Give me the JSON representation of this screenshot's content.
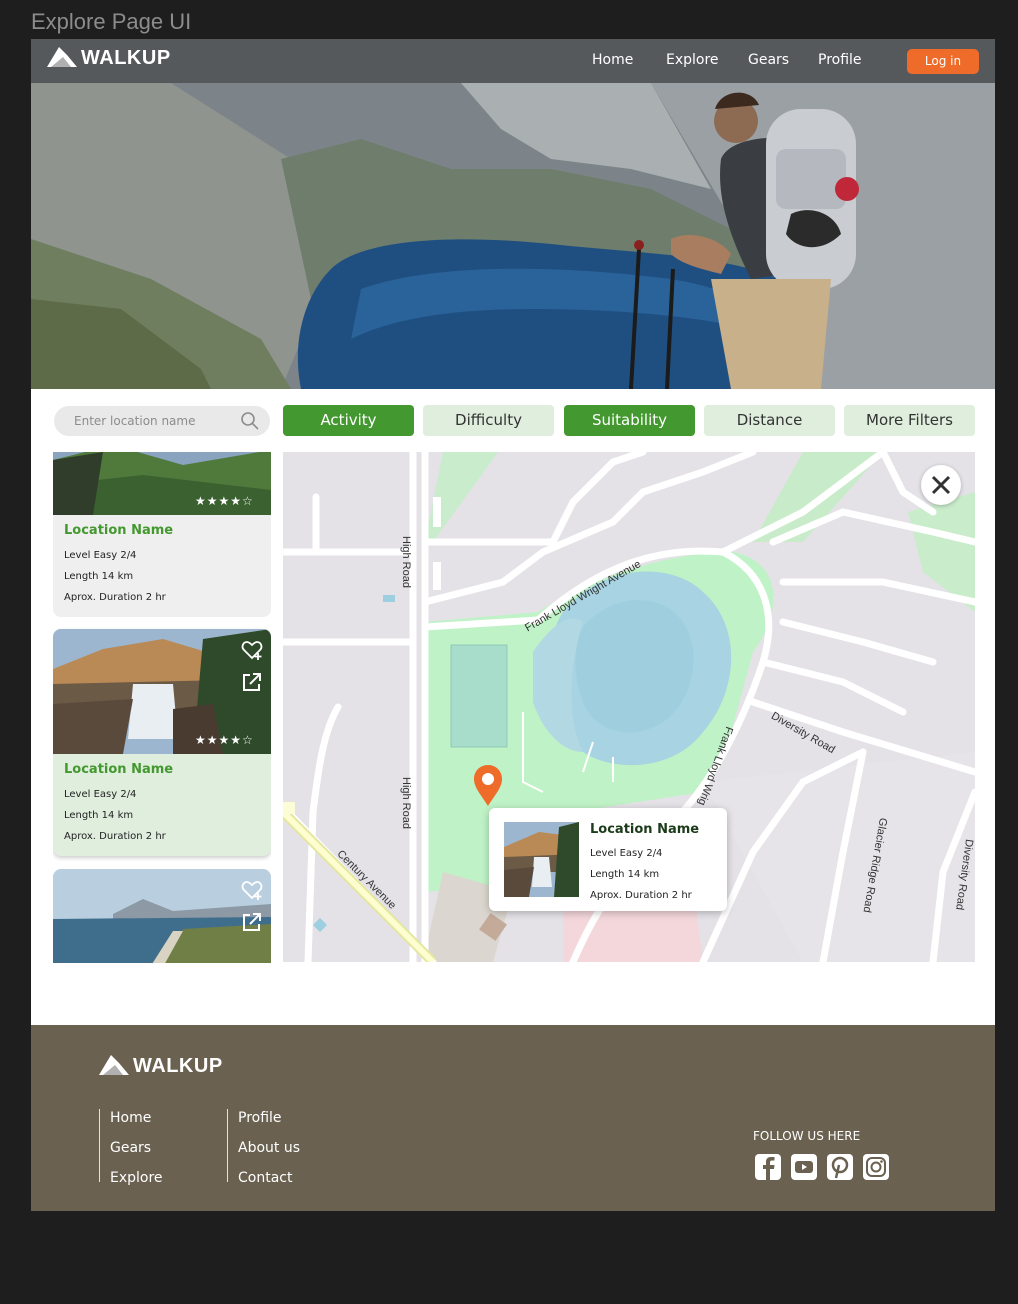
{
  "frame_title": "Explore Page UI",
  "brand": "WALKUP",
  "nav": {
    "links": [
      "Home",
      "Explore",
      "Gears",
      "Profile"
    ],
    "login": "Log in"
  },
  "search": {
    "placeholder": "Enter location name"
  },
  "filters": [
    {
      "label": "Activity",
      "active": true
    },
    {
      "label": "Difficulty",
      "active": false
    },
    {
      "label": "Suitability",
      "active": true
    },
    {
      "label": "Distance",
      "active": false
    },
    {
      "label": "More Filters",
      "active": false
    }
  ],
  "cards": [
    {
      "title": "Location Name",
      "level": "Level Easy 2/4",
      "length": "Length  14 km",
      "duration": "Aprox. Duration 2 hr",
      "rating": 4,
      "stars": "★★★★☆"
    },
    {
      "title": "Location Name",
      "level": "Level Easy 2/4",
      "length": "Length  14 km",
      "duration": "Aprox. Duration 2 hr",
      "rating": 4,
      "stars": "★★★★☆"
    }
  ],
  "map": {
    "roads": [
      "Frank Lloyd Wright Avenue",
      "High Road",
      "High Road",
      "Diversity Road",
      "Frank Lloyd Wrig",
      "Century Avenue",
      "Glacier Ridge Road",
      "Diversity Road"
    ],
    "popup": {
      "title": "Location Name",
      "level": "Level Easy 2/4",
      "length": "Length  14 km",
      "duration": "Aprox. Duration 2 hr"
    }
  },
  "footer": {
    "brand": "WALKUP",
    "col1": [
      "Home",
      "Gears",
      "Explore"
    ],
    "col2": [
      "Profile",
      "About us",
      "Contact"
    ],
    "follow": "FOLLOW US HERE",
    "social_icons": [
      "facebook-icon",
      "youtube-icon",
      "pinterest-icon",
      "instagram-icon"
    ]
  },
  "colors": {
    "accent_green": "#43982f",
    "accent_orange": "#ee6b2a",
    "footer_bg": "#6a6150"
  }
}
